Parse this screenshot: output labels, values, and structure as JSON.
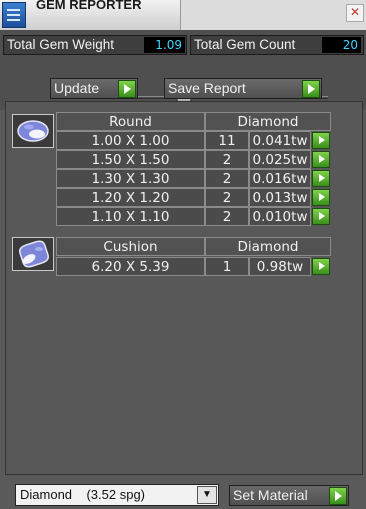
{
  "window": {
    "title": "GEM REPORTER",
    "close_symbol": "✕"
  },
  "stats": {
    "total_weight_label": "Total Gem Weight",
    "total_weight_value": "1.09",
    "total_count_label": "Total Gem Count",
    "total_count_value": "20"
  },
  "actions": {
    "update_label": "Update",
    "save_report_label": "Save Report"
  },
  "groups": [
    {
      "shape": "Round",
      "material": "Diamond",
      "rows": [
        {
          "size": "1.00 X 1.00",
          "count": "11",
          "weight": "0.041tw"
        },
        {
          "size": "1.50 X 1.50",
          "count": "2",
          "weight": "0.025tw"
        },
        {
          "size": "1.30 X 1.30",
          "count": "2",
          "weight": "0.016tw"
        },
        {
          "size": "1.20 X 1.20",
          "count": "2",
          "weight": "0.013tw"
        },
        {
          "size": "1.10 X 1.10",
          "count": "2",
          "weight": "0.010tw"
        }
      ]
    },
    {
      "shape": "Cushion",
      "material": "Diamond",
      "rows": [
        {
          "size": "6.20 X 5.39",
          "count": "1",
          "weight": "0.98tw"
        }
      ]
    }
  ],
  "material_select": {
    "value": "Diamond    (3.52 spg)"
  },
  "set_material_label": "Set Material"
}
